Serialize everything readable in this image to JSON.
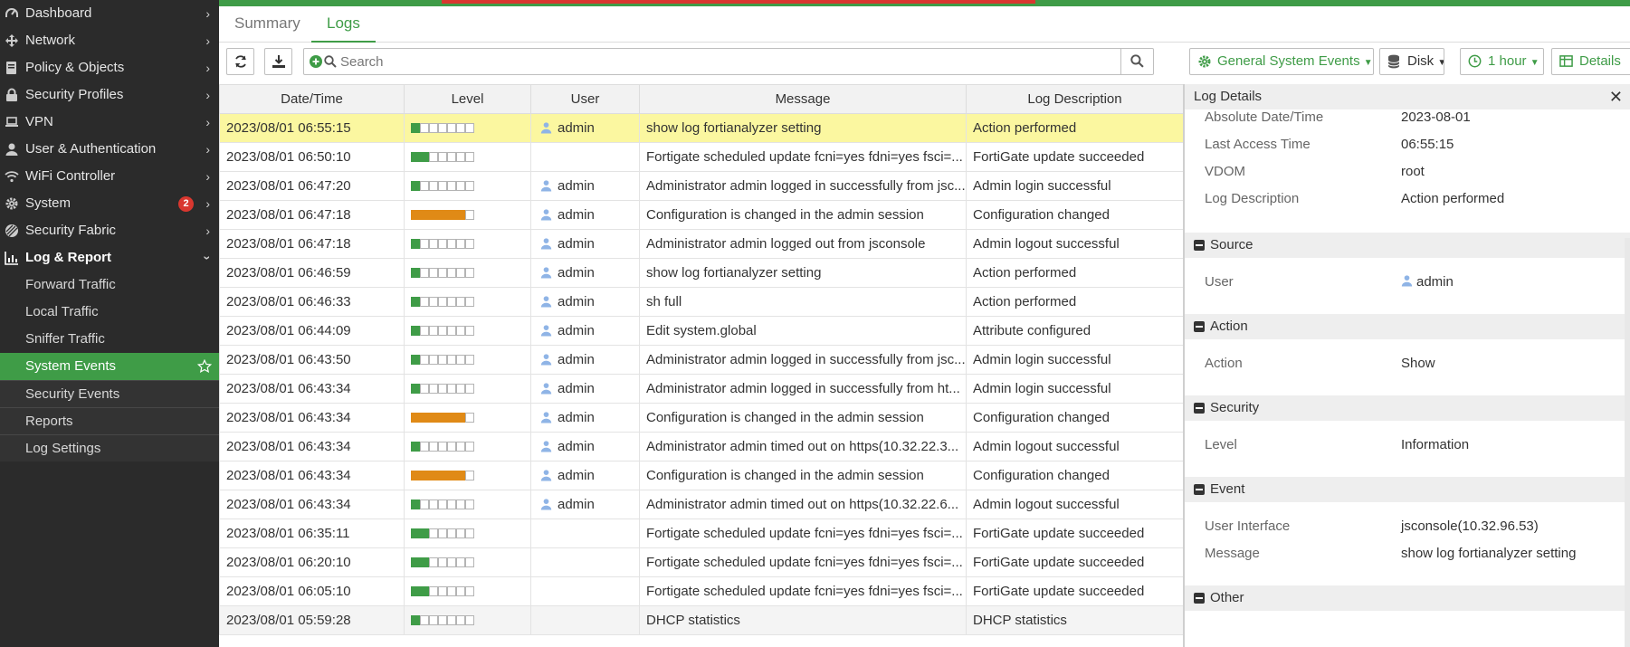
{
  "sidebar": {
    "items": [
      {
        "label": "Dashboard",
        "icon": "dashboard-icon"
      },
      {
        "label": "Network",
        "icon": "network-icon"
      },
      {
        "label": "Policy & Objects",
        "icon": "policy-icon"
      },
      {
        "label": "Security Profiles",
        "icon": "lock-icon"
      },
      {
        "label": "VPN",
        "icon": "laptop-icon"
      },
      {
        "label": "User & Authentication",
        "icon": "user-icon"
      },
      {
        "label": "WiFi Controller",
        "icon": "wifi-icon"
      },
      {
        "label": "System",
        "icon": "gear-icon",
        "badge": "2"
      },
      {
        "label": "Security Fabric",
        "icon": "fabric-icon"
      },
      {
        "label": "Log & Report",
        "icon": "chart-icon"
      }
    ],
    "subitems": [
      {
        "label": "Forward Traffic"
      },
      {
        "label": "Local Traffic"
      },
      {
        "label": "Sniffer Traffic"
      },
      {
        "label": "System Events"
      },
      {
        "label": "Security Events"
      },
      {
        "label": "Reports"
      },
      {
        "label": "Log Settings"
      }
    ]
  },
  "tabs": {
    "summary": "Summary",
    "logs": "Logs"
  },
  "toolbar": {
    "search_placeholder": "Search",
    "events_filter": "General System Events",
    "storage": "Disk",
    "time_range": "1 hour",
    "details": "Details"
  },
  "table": {
    "headers": [
      "Date/Time",
      "Level",
      "User",
      "Message",
      "Log Description"
    ],
    "rows": [
      {
        "datetime": "2023/08/01 06:55:15",
        "level": 1,
        "levelType": "info",
        "user": "admin",
        "message": "show log fortianalyzer setting",
        "desc": "Action performed"
      },
      {
        "datetime": "2023/08/01 06:50:10",
        "level": 2,
        "levelType": "notice",
        "user": "",
        "message": "Fortigate scheduled update fcni=yes fdni=yes fsci=...",
        "desc": "FortiGate update succeeded"
      },
      {
        "datetime": "2023/08/01 06:47:20",
        "level": 1,
        "levelType": "info",
        "user": "admin",
        "message": "Administrator admin logged in successfully from jsc...",
        "desc": "Admin login successful"
      },
      {
        "datetime": "2023/08/01 06:47:18",
        "level": 6,
        "levelType": "warn",
        "user": "admin",
        "message": "Configuration is changed in the admin session",
        "desc": "Configuration changed"
      },
      {
        "datetime": "2023/08/01 06:47:18",
        "level": 1,
        "levelType": "info",
        "user": "admin",
        "message": "Administrator admin logged out from jsconsole",
        "desc": "Admin logout successful"
      },
      {
        "datetime": "2023/08/01 06:46:59",
        "level": 1,
        "levelType": "info",
        "user": "admin",
        "message": "show log fortianalyzer setting",
        "desc": "Action performed"
      },
      {
        "datetime": "2023/08/01 06:46:33",
        "level": 1,
        "levelType": "info",
        "user": "admin",
        "message": "sh full",
        "desc": "Action performed"
      },
      {
        "datetime": "2023/08/01 06:44:09",
        "level": 1,
        "levelType": "info",
        "user": "admin",
        "message": "Edit system.global",
        "desc": "Attribute configured"
      },
      {
        "datetime": "2023/08/01 06:43:50",
        "level": 1,
        "levelType": "info",
        "user": "admin",
        "message": "Administrator admin logged in successfully from jsc...",
        "desc": "Admin login successful"
      },
      {
        "datetime": "2023/08/01 06:43:34",
        "level": 1,
        "levelType": "info",
        "user": "admin",
        "message": "Administrator admin logged in successfully from ht...",
        "desc": "Admin login successful"
      },
      {
        "datetime": "2023/08/01 06:43:34",
        "level": 6,
        "levelType": "warn",
        "user": "admin",
        "message": "Configuration is changed in the admin session",
        "desc": "Configuration changed"
      },
      {
        "datetime": "2023/08/01 06:43:34",
        "level": 1,
        "levelType": "info",
        "user": "admin",
        "message": "Administrator admin timed out on https(10.32.22.3...",
        "desc": "Admin logout successful"
      },
      {
        "datetime": "2023/08/01 06:43:34",
        "level": 6,
        "levelType": "warn",
        "user": "admin",
        "message": "Configuration is changed in the admin session",
        "desc": "Configuration changed"
      },
      {
        "datetime": "2023/08/01 06:43:34",
        "level": 1,
        "levelType": "info",
        "user": "admin",
        "message": "Administrator admin timed out on https(10.32.22.6...",
        "desc": "Admin logout successful"
      },
      {
        "datetime": "2023/08/01 06:35:11",
        "level": 2,
        "levelType": "notice",
        "user": "",
        "message": "Fortigate scheduled update fcni=yes fdni=yes fsci=...",
        "desc": "FortiGate update succeeded"
      },
      {
        "datetime": "2023/08/01 06:20:10",
        "level": 2,
        "levelType": "notice",
        "user": "",
        "message": "Fortigate scheduled update fcni=yes fdni=yes fsci=...",
        "desc": "FortiGate update succeeded"
      },
      {
        "datetime": "2023/08/01 06:05:10",
        "level": 2,
        "levelType": "notice",
        "user": "",
        "message": "Fortigate scheduled update fcni=yes fdni=yes fsci=...",
        "desc": "FortiGate update succeeded"
      },
      {
        "datetime": "2023/08/01 05:59:28",
        "level": 1,
        "levelType": "info",
        "user": "",
        "message": "DHCP statistics",
        "desc": "DHCP statistics"
      }
    ]
  },
  "details": {
    "title": "Log Details",
    "top": [
      {
        "k": "Absolute Date/Time",
        "v": "2023-08-01"
      },
      {
        "k": "Last Access Time",
        "v": "06:55:15"
      },
      {
        "k": "VDOM",
        "v": "root"
      },
      {
        "k": "Log Description",
        "v": "Action performed"
      }
    ],
    "source": {
      "title": "Source",
      "user_k": "User",
      "user_v": "admin"
    },
    "action": {
      "title": "Action",
      "k": "Action",
      "v": "Show"
    },
    "security": {
      "title": "Security",
      "k": "Level",
      "v": "Information"
    },
    "event": {
      "title": "Event",
      "ui_k": "User Interface",
      "ui_v": "jsconsole(10.32.96.53)",
      "msg_k": "Message",
      "msg_v": "show log fortianalyzer setting"
    },
    "other": {
      "title": "Other"
    }
  },
  "colors": {
    "accent": "#3f9c47",
    "warn": "#e08a16",
    "badge": "#d9372f",
    "selected_row": "#fbf7a0"
  }
}
